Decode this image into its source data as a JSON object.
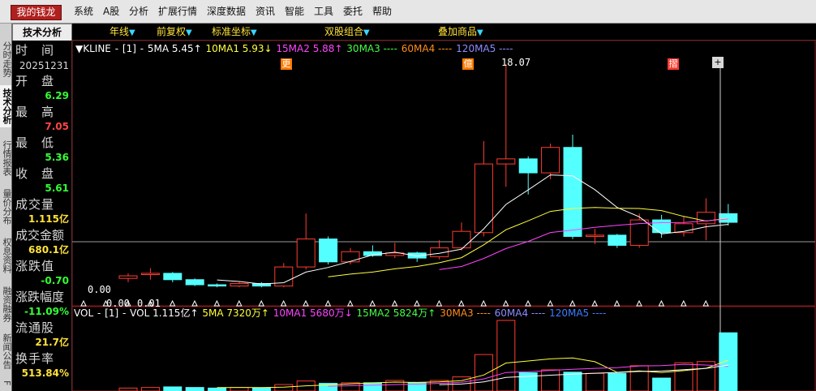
{
  "menubar": {
    "brand": "我的钱龙",
    "items": [
      "系统",
      "A股",
      "分析",
      "扩展行情",
      "深度数据",
      "资讯",
      "智能",
      "工具",
      "委托",
      "帮助"
    ]
  },
  "left_tabs": [
    "分时走势",
    "技术分析",
    "行情报表",
    "量价分布",
    "权息资料",
    "融资融券",
    "新闻公告"
  ],
  "left_tab_last": "F",
  "tech_tab": "技术分析",
  "toolbar": {
    "period": "年线",
    "adjust": "前复权",
    "axis": "标准坐标",
    "dual": "双股组合",
    "overlay": "叠加商品"
  },
  "info": {
    "time_label": "时　间",
    "date": "20251231",
    "open_label": "开　盘",
    "open": "6.29",
    "high_label": "最　高",
    "high": "7.05",
    "low_label": "最　低",
    "low": "5.36",
    "close_label": "收　盘",
    "close": "5.61",
    "volume_label": "成交量",
    "volume": "1.115亿",
    "amount_label": "成交金额",
    "amount": "680.1亿",
    "change_label": "涨跌值",
    "change": "-0.70",
    "pct_label": "涨跌幅度",
    "pct": "-11.09%",
    "float_label": "流通股",
    "float": "21.7亿",
    "turnover_label": "换手率",
    "turnover": "513.84%"
  },
  "kline_legend": {
    "title": "▼KLINE",
    "sep": "-",
    "code": "[1]",
    "dash2": "-",
    "ma5": "5MA 5.45↑",
    "ma10": "10MA1 5.93↓",
    "ma15": "15MA2 5.88↑",
    "ma30": "30MA3 ----",
    "ma60": "60MA4 ----",
    "ma120": "120MA5 ----"
  },
  "vol_legend": {
    "title": "VOL",
    "sep": "-",
    "code": "[1]",
    "dash2": "-",
    "vol": "VOL 1.115亿↑",
    "ma5": "5MA 7320万↑",
    "ma10": "10MA1 5680万↓",
    "ma15": "15MA2 5824万↑",
    "ma30": "30MA3 ----",
    "ma60": "60MA4 ----",
    "ma120": "120MA5 ----"
  },
  "annotations": {
    "marker1": "更",
    "marker2": "億",
    "marker3": "摺",
    "peak": "18.07",
    "zero1": "0.00",
    "zero2": "0.00",
    "zero3": "0.01"
  },
  "colors": {
    "up": "#ff3b30",
    "down": "#54ffff",
    "ma5": "#ffffff",
    "ma10": "#ffff3c",
    "ma15": "#ff44ff",
    "ma30": "#44ff44",
    "ma60": "#ff8c1a",
    "ma120": "#8c8cff",
    "label_green": "#33ff33",
    "label_red": "#ff4444",
    "label_yellow": "#ffe23a"
  },
  "chart_data": {
    "type": "candlestick",
    "note_series": [
      "open",
      "high",
      "low",
      "close",
      "volume"
    ],
    "candles": [
      {
        "open": 1.2,
        "high": 1.6,
        "low": 0.9,
        "close": 1.4,
        "dir": "up"
      },
      {
        "open": 1.5,
        "high": 2.0,
        "low": 1.1,
        "close": 1.6,
        "dir": "up"
      },
      {
        "open": 1.6,
        "high": 1.7,
        "low": 0.9,
        "close": 1.1,
        "dir": "down"
      },
      {
        "open": 1.1,
        "high": 1.2,
        "low": 0.6,
        "close": 0.7,
        "dir": "down"
      },
      {
        "open": 0.7,
        "high": 0.8,
        "low": 0.5,
        "close": 0.6,
        "dir": "down"
      },
      {
        "open": 0.6,
        "high": 0.9,
        "low": 0.5,
        "close": 0.8,
        "dir": "up"
      },
      {
        "open": 0.8,
        "high": 0.9,
        "low": 0.5,
        "close": 0.6,
        "dir": "down"
      },
      {
        "open": 0.6,
        "high": 2.4,
        "low": 0.5,
        "close": 2.1,
        "dir": "up"
      },
      {
        "open": 2.1,
        "high": 6.3,
        "low": 1.9,
        "close": 4.3,
        "dir": "up"
      },
      {
        "open": 4.3,
        "high": 4.5,
        "low": 2.3,
        "close": 2.5,
        "dir": "down"
      },
      {
        "open": 2.5,
        "high": 3.6,
        "low": 2.3,
        "close": 3.3,
        "dir": "up"
      },
      {
        "open": 3.3,
        "high": 3.8,
        "low": 2.9,
        "close": 3.0,
        "dir": "down"
      },
      {
        "open": 3.0,
        "high": 4.0,
        "low": 2.8,
        "close": 3.2,
        "dir": "up"
      },
      {
        "open": 3.2,
        "high": 3.3,
        "low": 2.5,
        "close": 2.8,
        "dir": "down"
      },
      {
        "open": 2.9,
        "high": 4.2,
        "low": 2.7,
        "close": 3.6,
        "dir": "up"
      },
      {
        "open": 3.6,
        "high": 5.6,
        "low": 3.4,
        "close": 4.9,
        "dir": "up"
      },
      {
        "open": 4.8,
        "high": 12.0,
        "low": 4.5,
        "close": 10.2,
        "dir": "up"
      },
      {
        "open": 10.2,
        "high": 18.07,
        "low": 8.4,
        "close": 10.6,
        "dir": "up"
      },
      {
        "open": 10.6,
        "high": 10.8,
        "low": 7.8,
        "close": 9.5,
        "dir": "down"
      },
      {
        "open": 9.5,
        "high": 11.8,
        "low": 9.0,
        "close": 11.5,
        "dir": "up"
      },
      {
        "open": 11.5,
        "high": 12.5,
        "low": 4.3,
        "close": 4.5,
        "dir": "down"
      },
      {
        "open": 4.5,
        "high": 5.1,
        "low": 3.9,
        "close": 4.6,
        "dir": "up"
      },
      {
        "open": 4.6,
        "high": 4.7,
        "low": 3.6,
        "close": 3.8,
        "dir": "down"
      },
      {
        "open": 3.8,
        "high": 6.3,
        "low": 3.6,
        "close": 5.8,
        "dir": "up"
      },
      {
        "open": 5.8,
        "high": 6.2,
        "low": 4.4,
        "close": 4.8,
        "dir": "down"
      },
      {
        "open": 4.8,
        "high": 6.1,
        "low": 4.5,
        "close": 5.5,
        "dir": "up"
      },
      {
        "open": 5.5,
        "high": 7.5,
        "low": 4.2,
        "close": 6.4,
        "dir": "up"
      },
      {
        "open": 6.29,
        "high": 7.05,
        "low": 5.36,
        "close": 5.61,
        "dir": "down"
      }
    ],
    "volumes": [
      0.05,
      0.06,
      0.07,
      0.06,
      0.05,
      0.06,
      0.05,
      0.11,
      0.17,
      0.13,
      0.14,
      0.14,
      0.18,
      0.14,
      0.18,
      0.24,
      0.62,
      1.2,
      0.31,
      0.36,
      0.32,
      0.3,
      0.3,
      0.43,
      0.22,
      0.48,
      0.5,
      0.99
    ],
    "ma5": [
      null,
      null,
      null,
      null,
      1.08,
      0.96,
      0.76,
      0.86,
      1.7,
      2.06,
      2.54,
      3.04,
      3.26,
      2.96,
      3.18,
      3.5,
      5.1,
      7.02,
      8.16,
      9.34,
      9.26,
      8.18,
      6.78,
      6.04,
      4.7,
      4.9,
      5.26,
      5.45
    ],
    "ma10": [
      null,
      null,
      null,
      null,
      null,
      null,
      null,
      null,
      null,
      1.33,
      1.54,
      1.7,
      1.95,
      2.14,
      2.43,
      2.83,
      3.84,
      5.03,
      5.73,
      6.47,
      6.7,
      6.78,
      6.72,
      6.7,
      6.53,
      6.07,
      5.71,
      5.93
    ],
    "ma15": [
      null,
      null,
      null,
      null,
      null,
      null,
      null,
      null,
      null,
      null,
      null,
      null,
      null,
      null,
      1.89,
      2.14,
      2.77,
      3.55,
      4.11,
      4.81,
      5.0,
      5.22,
      5.38,
      5.51,
      5.58,
      5.6,
      5.72,
      5.88
    ]
  }
}
